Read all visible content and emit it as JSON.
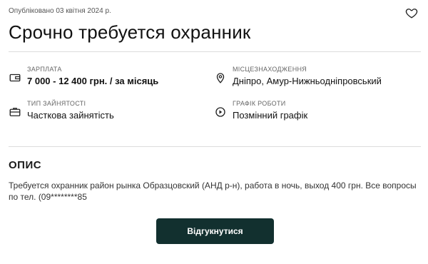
{
  "published": "Опубліковано 03 квітня 2024 р.",
  "title": "Срочно требуется охранник",
  "details": {
    "salary": {
      "label": "ЗАРПЛАТА",
      "value": "7 000 - 12 400 грн. / за місяць",
      "icon": "wallet-icon"
    },
    "location": {
      "label": "МІСЦЕЗНАХОДЖЕННЯ",
      "value": "Дніпро, Амур-Нижньодніпровський",
      "icon": "location-pin-icon"
    },
    "employment": {
      "label": "ТИП ЗАЙНЯТОСТІ",
      "value": "Часткова зайнятість",
      "icon": "briefcase-icon"
    },
    "schedule": {
      "label": "ГРАФІК РОБОТИ",
      "value": "Позмінний графік",
      "icon": "play-circle-icon"
    }
  },
  "description": {
    "heading": "ОПИС",
    "text": "Требуется охранник район рынка Образцовский (АНД р-н), работа в ночь, выход 400 грн. Все вопросы по тел. (09********85"
  },
  "actions": {
    "respond_label": "Відгукнутися",
    "favorite_icon": "heart-icon"
  },
  "colors": {
    "button_bg": "#12302f",
    "divider": "#dcdcdc"
  }
}
